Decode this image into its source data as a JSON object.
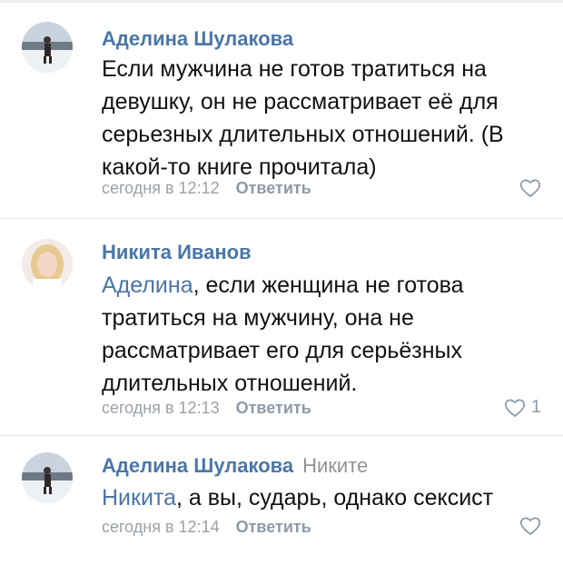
{
  "comments": [
    {
      "author": "Аделина Шулакова",
      "reply_to": "",
      "mention": "",
      "text": "Если мужчина не готов тратиться на девушку, он не рассматривает её для серьезных длительных отношений. (В какой-то книге прочитала)",
      "time": "сегодня в 12:12",
      "reply_label": "Ответить",
      "likes": "",
      "avatar_icon": "winter-photo-avatar"
    },
    {
      "author": "Никита Иванов",
      "reply_to": "",
      "mention": "Аделина",
      "text": ", если женщина не готова тратиться на мужчину, она не рассматривает его для серьёзных длительных отношений.",
      "time": "сегодня в 12:13",
      "reply_label": "Ответить",
      "likes": "1",
      "avatar_icon": "blonde-woman-avatar"
    },
    {
      "author": "Аделина Шулакова",
      "reply_to": "Никите",
      "mention": "Никита",
      "text": ", а вы, сударь, однако сексист",
      "time": "сегодня в 12:14",
      "reply_label": "Ответить",
      "likes": "",
      "avatar_icon": "winter-photo-avatar"
    }
  ],
  "colors": {
    "link": "#4a76a8",
    "meta": "#9aa1a8",
    "text": "#111111"
  }
}
